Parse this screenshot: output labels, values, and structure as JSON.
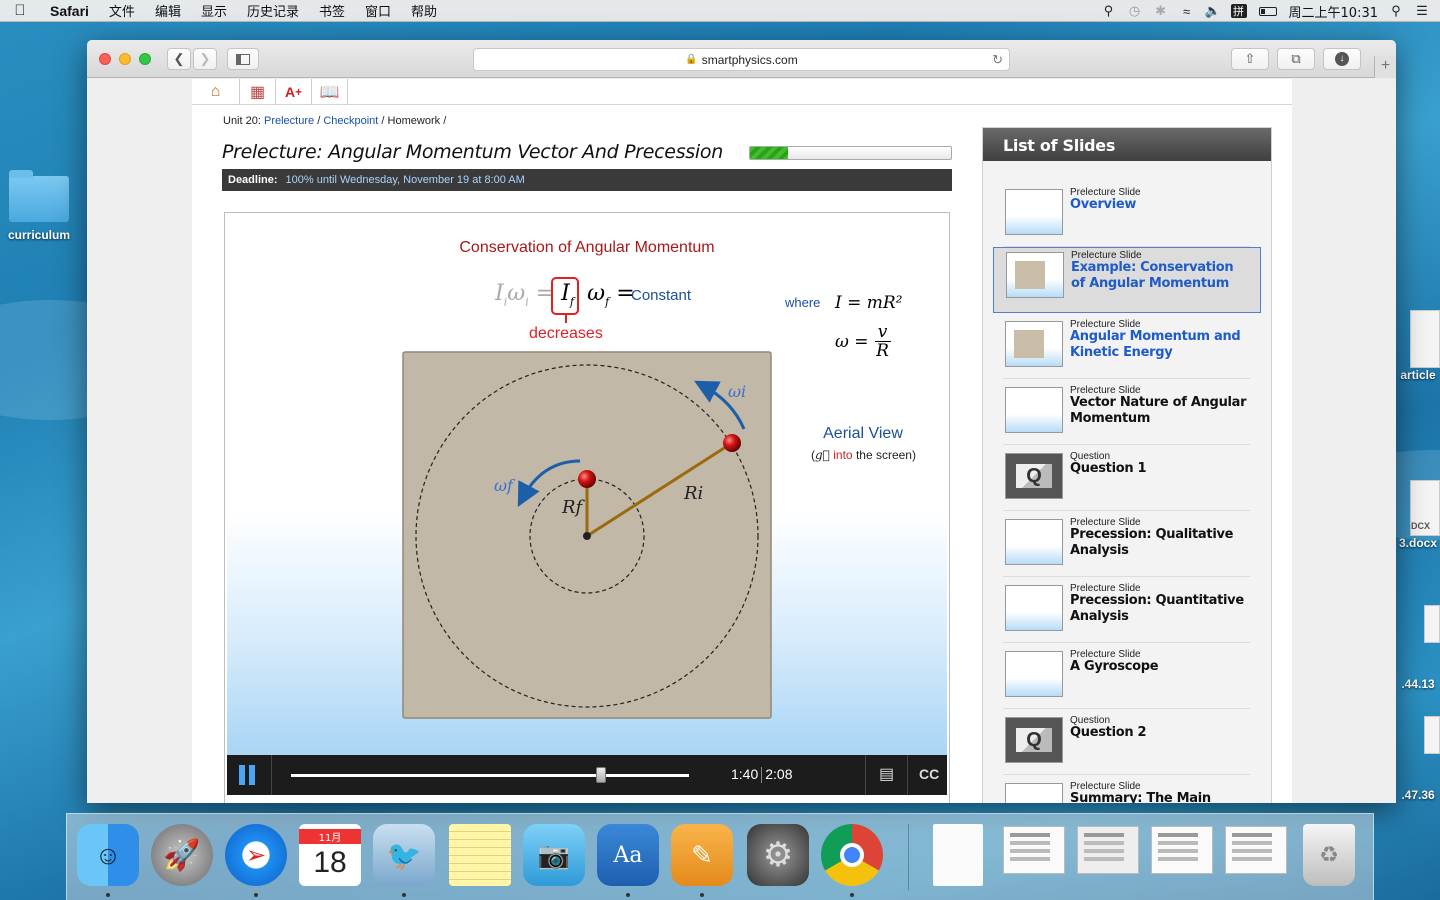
{
  "menubar": {
    "app": "Safari",
    "items": [
      "文件",
      "编辑",
      "显示",
      "历史记录",
      "书签",
      "窗口",
      "帮助"
    ],
    "clock": "周二上午10:31",
    "input_method": "拼"
  },
  "desktop": {
    "folder_label": "curriculum",
    "right_labels": [
      "article",
      "3.docx",
      ".44.13",
      ".47.36",
      "DCX"
    ]
  },
  "browser": {
    "url": "smartphysics.com"
  },
  "page": {
    "breadcrumb": {
      "unit": "Unit 20:",
      "prelecture": "Prelecture",
      "checkpoint": "Checkpoint",
      "homework": "Homework",
      "sep": "/"
    },
    "title": "Prelecture: Angular Momentum Vector And Precession",
    "progress_percent": 19,
    "deadline_label": "Deadline:",
    "deadline_value": "100% until Wednesday, November 19 at 8:00 AM"
  },
  "slide": {
    "title": "Conservation of Angular Momentum",
    "eq_left": "I",
    "eq_left_sub": "i",
    "eq_omega_i": "ω",
    "eq_omega_i_sub": "i",
    "eq_equals": "=",
    "eq_if": "I",
    "eq_if_sub": "f",
    "eq_omega_f": "ω",
    "eq_omega_f_sub": "f",
    "eq_equals2": "=",
    "constant": "Constant",
    "decreases": "decreases",
    "where": "where",
    "formula_I": "I = mR²",
    "formula_omega_lhs": "ω =",
    "formula_omega_num": "v",
    "formula_omega_den": "R",
    "aerial_view": "Aerial View",
    "aerial_paren_open": "(",
    "aerial_g": "g⃗",
    "aerial_into": "into",
    "aerial_rest": "the screen)",
    "label_omega_i": "ωi",
    "label_omega_f": "ωf",
    "label_Rf": "Rf",
    "label_Ri": "Ri"
  },
  "video": {
    "current_time": "1:40",
    "total_time": "2:08",
    "progress_fraction": 0.78,
    "cc_label": "CC"
  },
  "slides_panel": {
    "title": "List of Slides",
    "items": [
      {
        "type": "Prelecture Slide",
        "name": "Overview",
        "active": false,
        "blue": true,
        "thumb": "blank"
      },
      {
        "type": "Prelecture Slide",
        "name": "Example: Conservation of Angular Momentum",
        "active": true,
        "blue": true,
        "thumb": "box"
      },
      {
        "type": "Prelecture Slide",
        "name": "Angular Momentum and Kinetic Energy",
        "active": false,
        "blue": true,
        "thumb": "box"
      },
      {
        "type": "Prelecture Slide",
        "name": "Vector Nature of Angular Momentum",
        "active": false,
        "blue": false,
        "thumb": "blank"
      },
      {
        "type": "Question",
        "name": "Question 1",
        "active": false,
        "blue": false,
        "thumb": "q"
      },
      {
        "type": "Prelecture Slide",
        "name": "Precession: Qualitative Analysis",
        "active": false,
        "blue": false,
        "thumb": "blank"
      },
      {
        "type": "Prelecture Slide",
        "name": "Precession: Quantitative Analysis",
        "active": false,
        "blue": false,
        "thumb": "blank"
      },
      {
        "type": "Prelecture Slide",
        "name": "A Gyroscope",
        "active": false,
        "blue": false,
        "thumb": "blank"
      },
      {
        "type": "Question",
        "name": "Question 2",
        "active": false,
        "blue": false,
        "thumb": "q"
      },
      {
        "type": "Prelecture Slide",
        "name": "Summary: The Main Ideas",
        "active": false,
        "blue": false,
        "thumb": "blank"
      }
    ]
  },
  "dock": {
    "calendar_month": "11月",
    "calendar_day": "18",
    "apps": [
      "finder-icon",
      "launchpad-icon",
      "safari-icon",
      "calendar-icon",
      "mail-icon",
      "notes-icon",
      "iphoto-icon",
      "dictionary-icon",
      "pages-icon",
      "system-preferences-icon",
      "chrome-icon"
    ]
  },
  "colors": {
    "link_blue": "#1b4fa3",
    "slide_red": "#a81818",
    "accent_blue": "#4aa6f5",
    "progress_green": "#3fbf2a"
  }
}
